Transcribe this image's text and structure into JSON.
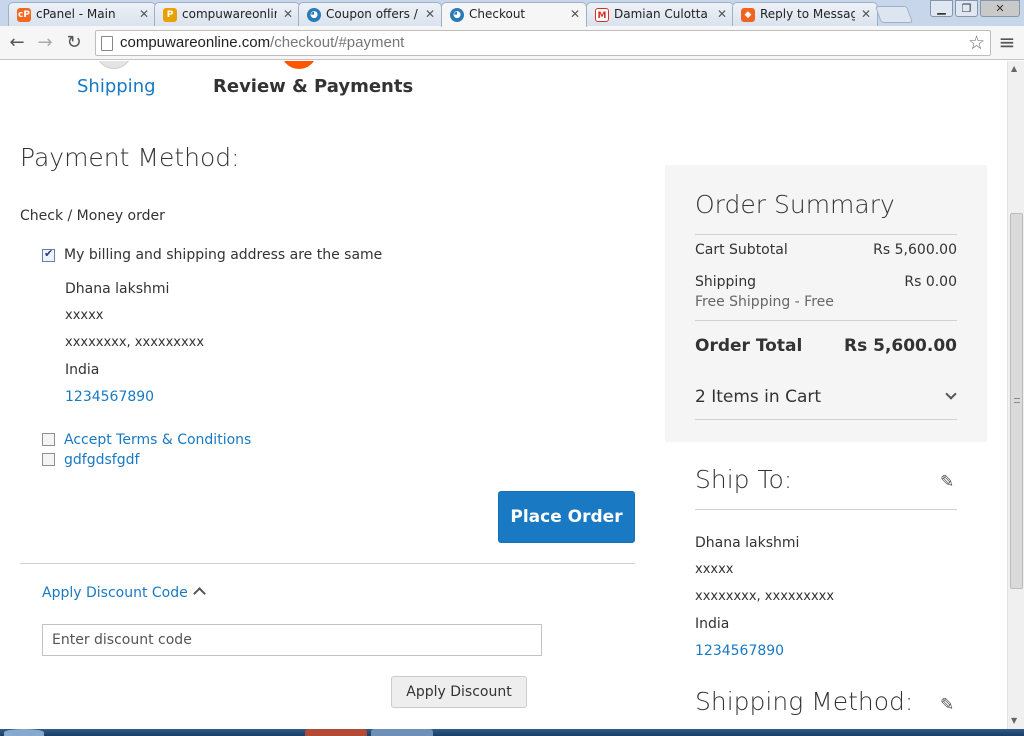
{
  "browser": {
    "tabs": [
      {
        "title": "cPanel - Main",
        "icon": "cpanel-icon",
        "color": "#f26722"
      },
      {
        "title": "compuwareonlin",
        "icon": "phpmyadmin-icon",
        "color": "#e7a100"
      },
      {
        "title": "Coupon offers / I",
        "icon": "magento-site-icon",
        "color": "#2a7ab8"
      },
      {
        "title": "Checkout",
        "icon": "magento-site-icon",
        "color": "#2a7ab8"
      },
      {
        "title": "Damian Culotta r",
        "icon": "gmail-icon",
        "color": "#d93025"
      },
      {
        "title": "Reply to Message",
        "icon": "magento-icon",
        "color": "#f26322"
      }
    ],
    "url_host": "compuwareonline.com",
    "url_path": "/checkout/#payment"
  },
  "steps": {
    "shipping_label": "Shipping",
    "review_label": "Review & Payments",
    "active_color": "#ff5501"
  },
  "payment": {
    "heading": "Payment Method:",
    "method_name": "Check / Money order",
    "same_address_label": "My billing and shipping address are the same",
    "same_address_checked": true,
    "address": {
      "name": "Dhana lakshmi",
      "line1": "xxxxx",
      "line2": "xxxxxxxx, xxxxxxxxx",
      "country": "India",
      "phone": "1234567890"
    },
    "terms_label": "Accept Terms & Conditions",
    "extra_agreement_label": "gdfgdsfgdf",
    "place_order_label": "Place Order"
  },
  "discount": {
    "toggle_label": "Apply Discount Code",
    "input_placeholder": "Enter discount code",
    "apply_label": "Apply Discount"
  },
  "summary": {
    "title": "Order Summary",
    "cart_subtotal_label": "Cart Subtotal",
    "cart_subtotal_value": "Rs 5,600.00",
    "shipping_label": "Shipping",
    "shipping_value": "Rs 0.00",
    "shipping_method": "Free Shipping - Free",
    "order_total_label": "Order Total",
    "order_total_value": "Rs 5,600.00",
    "items_in_cart": "2 Items in Cart"
  },
  "ship_to": {
    "heading": "Ship To:",
    "name": "Dhana lakshmi",
    "line1": "xxxxx",
    "line2": "xxxxxxxx, xxxxxxxxx",
    "country": "India",
    "phone": "1234567890"
  },
  "shipping_method": {
    "heading": "Shipping Method:"
  },
  "colors": {
    "primary_blue": "#1979c3",
    "summary_bg": "#f5f5f5"
  }
}
